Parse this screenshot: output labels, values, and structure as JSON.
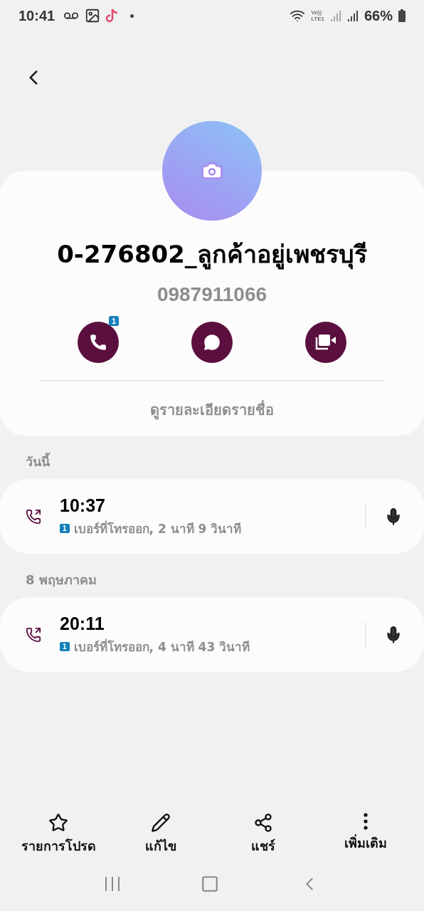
{
  "status_bar": {
    "time": "10:41",
    "network_label_top": "Vo))",
    "network_label_bottom": "LTE1",
    "battery": "66%"
  },
  "contact": {
    "name": "0-276802_ลูกค้าอยู่เพชรบุรี",
    "number": "0987911066",
    "details_link": "ดูรายละเอียดรายชื่อ"
  },
  "actions": [
    {
      "kind": "call",
      "badge": "1"
    },
    {
      "kind": "message"
    },
    {
      "kind": "video"
    }
  ],
  "call_groups": [
    {
      "heading": "วันนี้",
      "calls": [
        {
          "time": "10:37",
          "sim": "1",
          "detail": "เบอร์ที่โทรออก, 2 นาที 9 วินาที"
        }
      ]
    },
    {
      "heading": "8 พฤษภาคม",
      "calls": [
        {
          "time": "20:11",
          "sim": "1",
          "detail": "เบอร์ที่โทรออก, 4 นาที 43 วินาที"
        }
      ]
    }
  ],
  "bottom_actions": [
    {
      "kind": "favorite",
      "label": "รายการโปรด"
    },
    {
      "kind": "edit",
      "label": "แก้ไข"
    },
    {
      "kind": "share",
      "label": "แชร์"
    },
    {
      "kind": "more",
      "label": "เพิ่มเติม"
    }
  ]
}
